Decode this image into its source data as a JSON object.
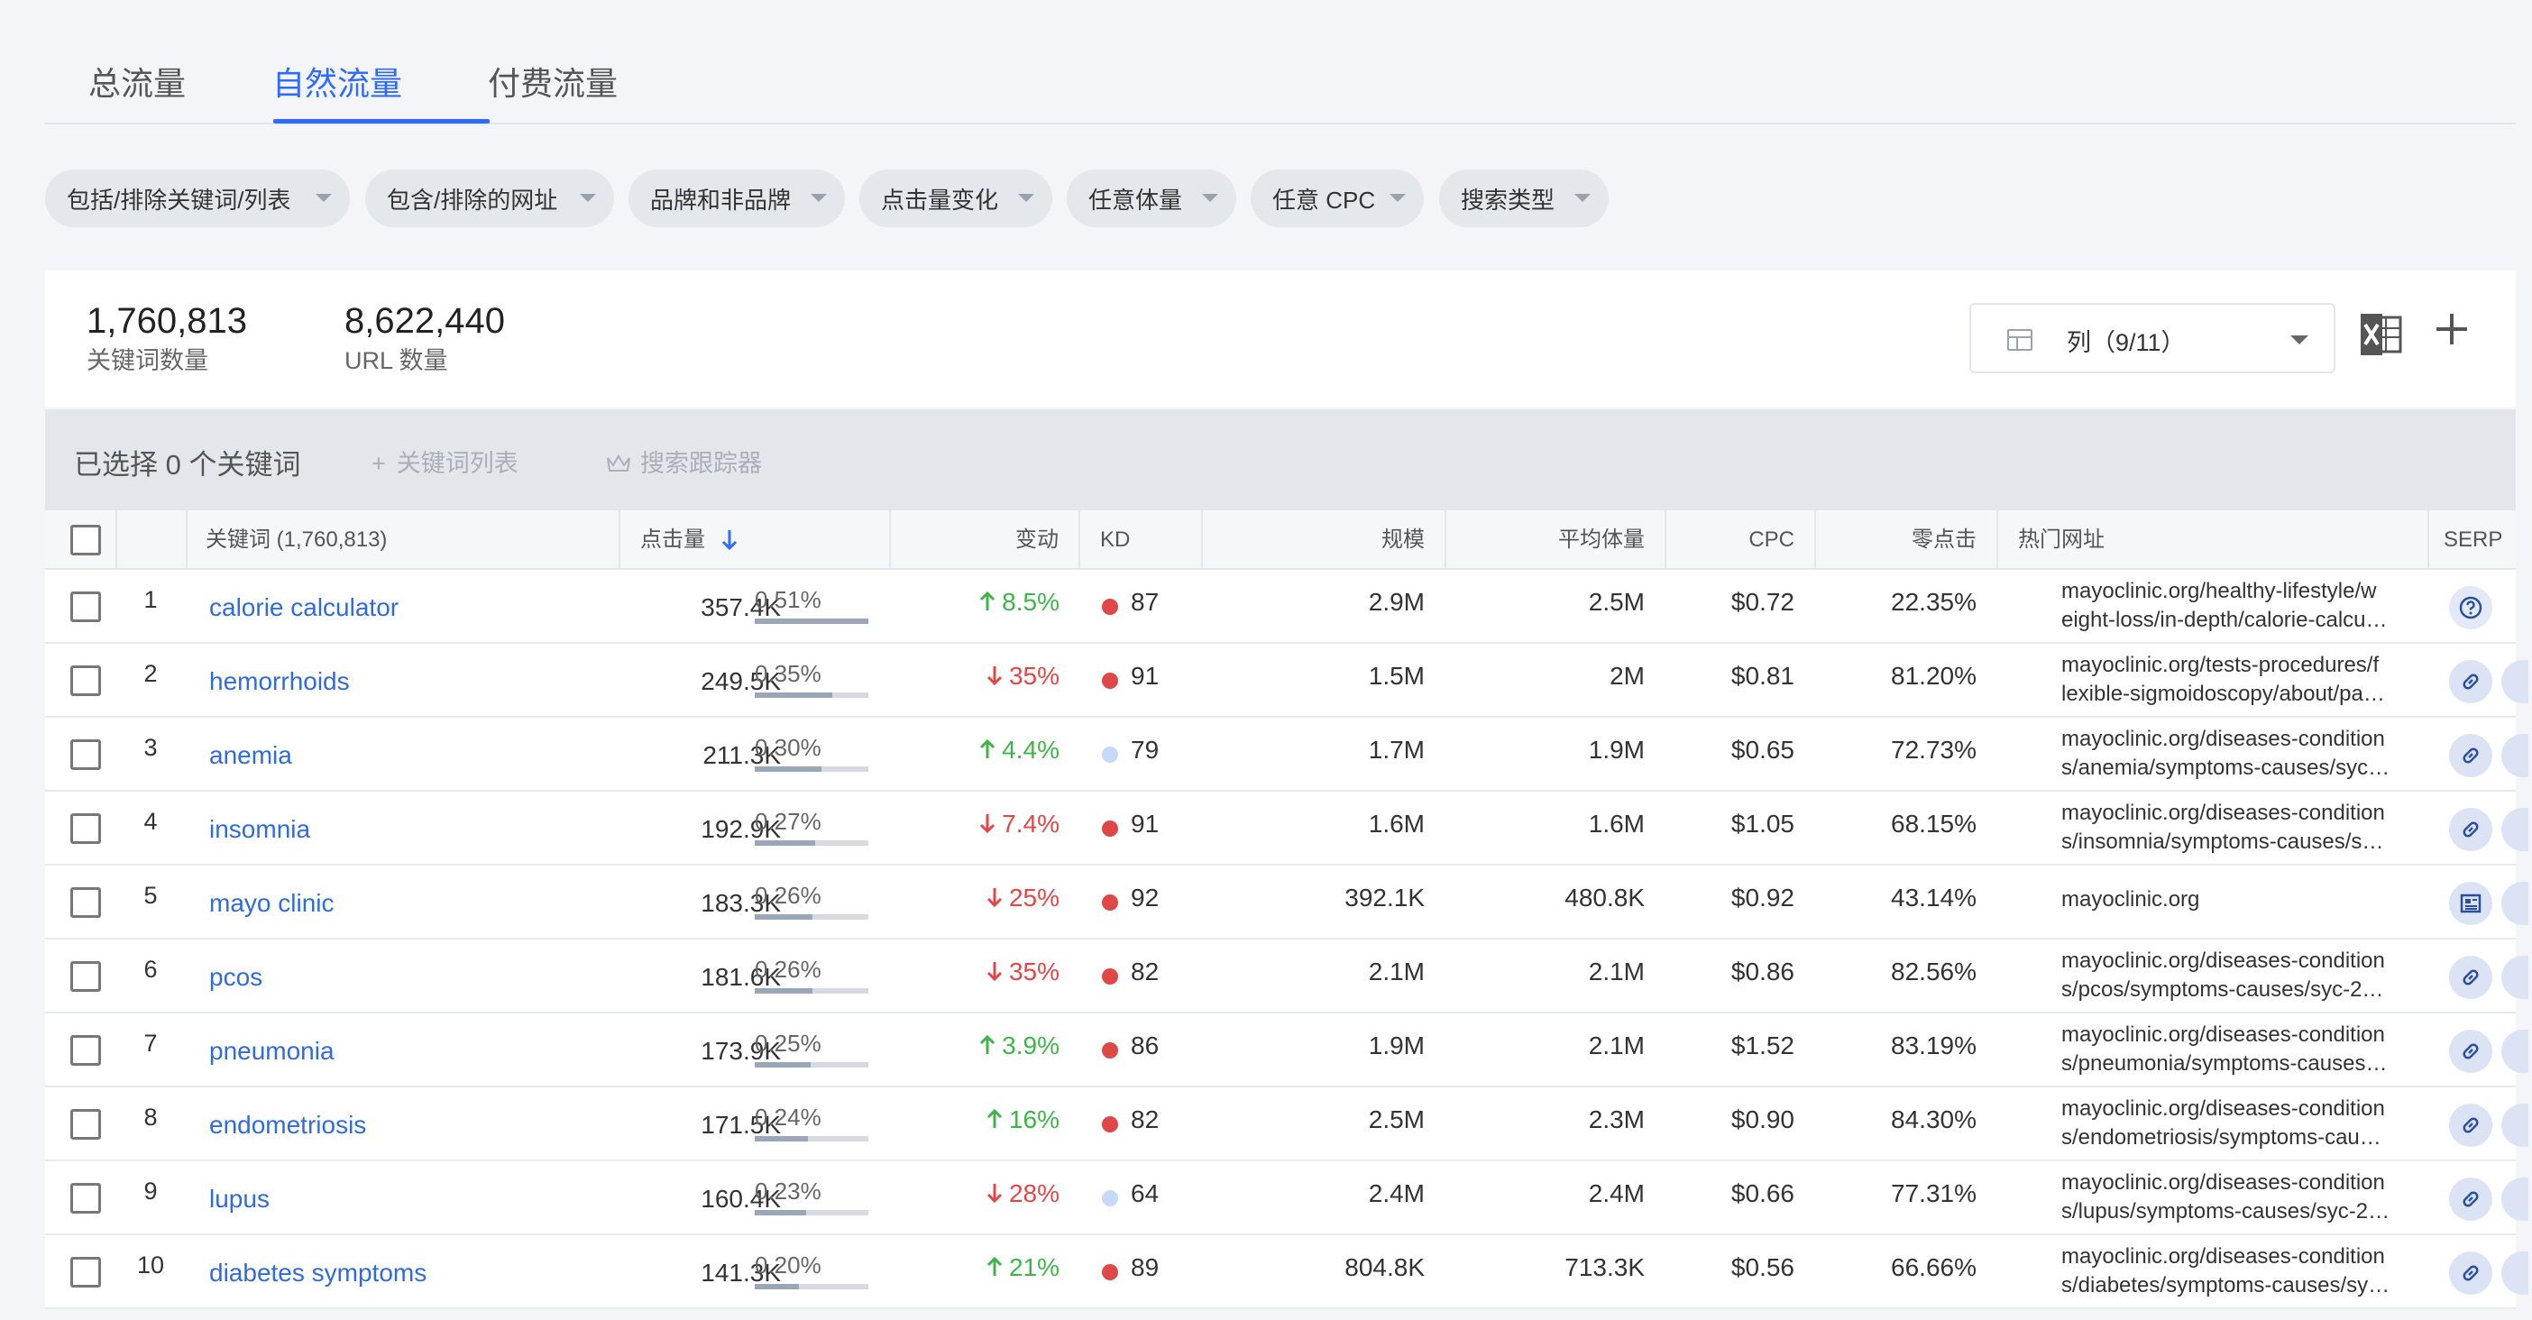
{
  "tabs": [
    {
      "label": "总流量"
    },
    {
      "label": "自然流量"
    },
    {
      "label": "付费流量"
    }
  ],
  "filters": [
    {
      "label": "包括/排除关键词/列表"
    },
    {
      "label": "包含/排除的网址"
    },
    {
      "label": "品牌和非品牌"
    },
    {
      "label": "点击量变化"
    },
    {
      "label": "任意体量"
    },
    {
      "label": "任意 CPC"
    },
    {
      "label": "搜索类型"
    }
  ],
  "summary": {
    "keywords_count": "1,760,813",
    "keywords_label": "关键词数量",
    "url_count": "8,622,440",
    "url_label": "URL 数量",
    "columns_label": "列（9/11）"
  },
  "selection": {
    "text": "已选择 0 个关键词",
    "keyword_list": "关键词列表",
    "tracker": "搜索跟踪器"
  },
  "columns": {
    "keyword": "关键词 (1,760,813)",
    "clicks": "点击量",
    "change": "变动",
    "kd": "KD",
    "scale": "规模",
    "avg_volume": "平均体量",
    "cpc": "CPC",
    "zero_click": "零点击",
    "top_url": "热门网址",
    "serp": "SERP"
  },
  "colors": {
    "accent": "#2f6bff",
    "up": "#3fb549",
    "down": "#e04848",
    "kd_hard": "#e04848",
    "kd_easy": "#c6d9f7"
  },
  "rows": [
    {
      "n": "1",
      "keyword": "calorie calculator",
      "clicks": "357.4K",
      "share": "0.51%",
      "share_value": 0.51,
      "dir": "up",
      "change": "8.5%",
      "kd_color": "red",
      "kd": "87",
      "scale": "2.9M",
      "avg": "2.5M",
      "cpc": "$0.72",
      "zero": "22.35%",
      "url1": "mayoclinic.org/healthy-lifestyle/w",
      "url2": "eight-loss/in-depth/calorie-calcu…",
      "serp_icon": "question-icon"
    },
    {
      "n": "2",
      "keyword": "hemorrhoids",
      "clicks": "249.5K",
      "share": "0.35%",
      "share_value": 0.35,
      "dir": "down",
      "change": "35%",
      "kd_color": "red",
      "kd": "91",
      "scale": "1.5M",
      "avg": "2M",
      "cpc": "$0.81",
      "zero": "81.20%",
      "url1": "mayoclinic.org/tests-procedures/f",
      "url2": "lexible-sigmoidoscopy/about/pa…",
      "serp_icon": "link-icon"
    },
    {
      "n": "3",
      "keyword": "anemia",
      "clicks": "211.3K",
      "share": "0.30%",
      "share_value": 0.3,
      "dir": "up",
      "change": "4.4%",
      "kd_color": "blue",
      "kd": "79",
      "scale": "1.7M",
      "avg": "1.9M",
      "cpc": "$0.65",
      "zero": "72.73%",
      "url1": "mayoclinic.org/diseases-condition",
      "url2": "s/anemia/symptoms-causes/syc…",
      "serp_icon": "link-icon"
    },
    {
      "n": "4",
      "keyword": "insomnia",
      "clicks": "192.9K",
      "share": "0.27%",
      "share_value": 0.27,
      "dir": "down",
      "change": "7.4%",
      "kd_color": "red",
      "kd": "91",
      "scale": "1.6M",
      "avg": "1.6M",
      "cpc": "$1.05",
      "zero": "68.15%",
      "url1": "mayoclinic.org/diseases-condition",
      "url2": "s/insomnia/symptoms-causes/s…",
      "serp_icon": "link-icon"
    },
    {
      "n": "5",
      "keyword": "mayo clinic",
      "clicks": "183.3K",
      "share": "0.26%",
      "share_value": 0.26,
      "dir": "down",
      "change": "25%",
      "kd_color": "red",
      "kd": "92",
      "scale": "392.1K",
      "avg": "480.8K",
      "cpc": "$0.92",
      "zero": "43.14%",
      "url1": "mayoclinic.org",
      "url2": "",
      "serp_icon": "news-icon"
    },
    {
      "n": "6",
      "keyword": "pcos",
      "clicks": "181.6K",
      "share": "0.26%",
      "share_value": 0.26,
      "dir": "down",
      "change": "35%",
      "kd_color": "red",
      "kd": "82",
      "scale": "2.1M",
      "avg": "2.1M",
      "cpc": "$0.86",
      "zero": "82.56%",
      "url1": "mayoclinic.org/diseases-condition",
      "url2": "s/pcos/symptoms-causes/syc-2…",
      "serp_icon": "link-icon"
    },
    {
      "n": "7",
      "keyword": "pneumonia",
      "clicks": "173.9K",
      "share": "0.25%",
      "share_value": 0.25,
      "dir": "up",
      "change": "3.9%",
      "kd_color": "red",
      "kd": "86",
      "scale": "1.9M",
      "avg": "2.1M",
      "cpc": "$1.52",
      "zero": "83.19%",
      "url1": "mayoclinic.org/diseases-condition",
      "url2": "s/pneumonia/symptoms-causes…",
      "serp_icon": "link-icon"
    },
    {
      "n": "8",
      "keyword": "endometriosis",
      "clicks": "171.5K",
      "share": "0.24%",
      "share_value": 0.24,
      "dir": "up",
      "change": "16%",
      "kd_color": "red",
      "kd": "82",
      "scale": "2.5M",
      "avg": "2.3M",
      "cpc": "$0.90",
      "zero": "84.30%",
      "url1": "mayoclinic.org/diseases-condition",
      "url2": "s/endometriosis/symptoms-cau…",
      "serp_icon": "link-icon"
    },
    {
      "n": "9",
      "keyword": "lupus",
      "clicks": "160.4K",
      "share": "0.23%",
      "share_value": 0.23,
      "dir": "down",
      "change": "28%",
      "kd_color": "blue",
      "kd": "64",
      "scale": "2.4M",
      "avg": "2.4M",
      "cpc": "$0.66",
      "zero": "77.31%",
      "url1": "mayoclinic.org/diseases-condition",
      "url2": "s/lupus/symptoms-causes/syc-2…",
      "serp_icon": "link-icon"
    },
    {
      "n": "10",
      "keyword": "diabetes symptoms",
      "clicks": "141.3K",
      "share": "0.20%",
      "share_value": 0.2,
      "dir": "up",
      "change": "21%",
      "kd_color": "red",
      "kd": "89",
      "scale": "804.8K",
      "avg": "713.3K",
      "cpc": "$0.56",
      "zero": "66.66%",
      "url1": "mayoclinic.org/diseases-condition",
      "url2": "s/diabetes/symptoms-causes/sy…",
      "serp_icon": "link-icon"
    }
  ]
}
